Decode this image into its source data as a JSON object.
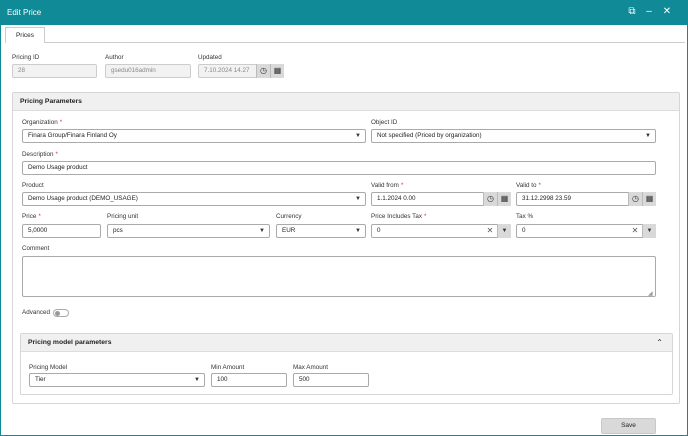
{
  "window": {
    "title": "Edit Price"
  },
  "tabs": [
    {
      "label": "Prices"
    }
  ],
  "meta": {
    "pricing_id_label": "Pricing ID",
    "pricing_id_value": "28",
    "author_label": "Author",
    "author_value": "gsedu016admin",
    "updated_label": "Updated",
    "updated_value": "7.10.2024 14.27"
  },
  "params": {
    "title": "Pricing Parameters",
    "organization": {
      "label": "Organization",
      "value": "Finara Group/Finara Finland Oy"
    },
    "object_id": {
      "label": "Object ID",
      "value": "Not specified (Priced by organization)"
    },
    "description": {
      "label": "Description",
      "value": "Demo Usage product"
    },
    "product": {
      "label": "Product",
      "value": "Demo Usage product (DEMO_USAGE)"
    },
    "valid_from": {
      "label": "Valid from",
      "value": "1.1.2024 0.00"
    },
    "valid_to": {
      "label": "Valid to",
      "value": "31.12.2998 23.59"
    },
    "price": {
      "label": "Price",
      "value": "5,0000"
    },
    "pricing_unit": {
      "label": "Pricing unit",
      "value": "pcs"
    },
    "currency": {
      "label": "Currency",
      "value": "EUR"
    },
    "price_includes_tax": {
      "label": "Price Includes Tax",
      "value": "0"
    },
    "tax_pct": {
      "label": "Tax %",
      "value": "0"
    },
    "comment": {
      "label": "Comment",
      "value": ""
    },
    "advanced": {
      "label": "Advanced",
      "enabled": false
    }
  },
  "model": {
    "title": "Pricing model parameters",
    "pricing_model": {
      "label": "Pricing Model",
      "value": "Tier"
    },
    "min_amount": {
      "label": "Min Amount",
      "value": "100"
    },
    "max_amount": {
      "label": "Max Amount",
      "value": "500"
    }
  },
  "footer": {
    "save_label": "Save"
  },
  "colors": {
    "titlebar": "#0f8a96",
    "required": "#dd3333"
  }
}
